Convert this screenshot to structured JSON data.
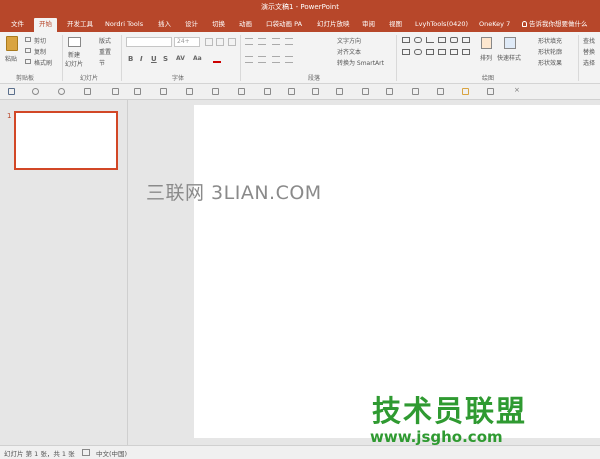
{
  "window": {
    "title": "演示文稿1 - PowerPoint"
  },
  "tabs": [
    {
      "label": "文件"
    },
    {
      "label": "开始"
    },
    {
      "label": "开发工具"
    },
    {
      "label": "Nordri Tools"
    },
    {
      "label": "插入"
    },
    {
      "label": "设计"
    },
    {
      "label": "切换"
    },
    {
      "label": "动画"
    },
    {
      "label": "口袋动画 PA"
    },
    {
      "label": "幻灯片放映"
    },
    {
      "label": "审阅"
    },
    {
      "label": "视图"
    },
    {
      "label": "LvyhTools(0420)"
    },
    {
      "label": "OneKey 7"
    }
  ],
  "active_tab": "开始",
  "tell_me": "告诉我你想要做什么",
  "ribbon": {
    "clipboard": {
      "paste": "粘贴",
      "cut": "剪切",
      "copy": "复制",
      "format_painter": "格式刷",
      "label": "剪贴板"
    },
    "slides": {
      "new_slide": "新建",
      "new_slide2": "幻灯片",
      "layout": "版式",
      "reset": "重置",
      "section": "节",
      "label": "幻灯片"
    },
    "font": {
      "size": "24+",
      "label": "字体",
      "bold": "B",
      "italic": "I",
      "underline": "U",
      "strike": "S",
      "spacing": "AV",
      "case": "Aa"
    },
    "paragraph": {
      "text_direction": "文字方向",
      "align_text": "对齐文本",
      "smartart": "转换为 SmartArt",
      "label": "段落"
    },
    "drawing": {
      "arrange": "排列",
      "quick_styles": "快速样式",
      "shape_fill": "形状填充",
      "shape_outline": "形状轮廓",
      "shape_effects": "形状效果",
      "label": "绘图"
    },
    "editing": {
      "find": "查找",
      "replace": "替换",
      "select": "选择"
    }
  },
  "slides_pane": {
    "slide_number": "1"
  },
  "watermark": "三联网 3LIAN.COM",
  "brand_watermark": {
    "text": "技术员联盟",
    "url": "www.jsgho.com"
  },
  "status": {
    "slide_info": "幻灯片 第 1 张，共 1 张",
    "language": "中文(中国)"
  },
  "colors": {
    "accent": "#b7472a",
    "thumb_border": "#d24726",
    "watermark_green": "#2f9a31"
  }
}
